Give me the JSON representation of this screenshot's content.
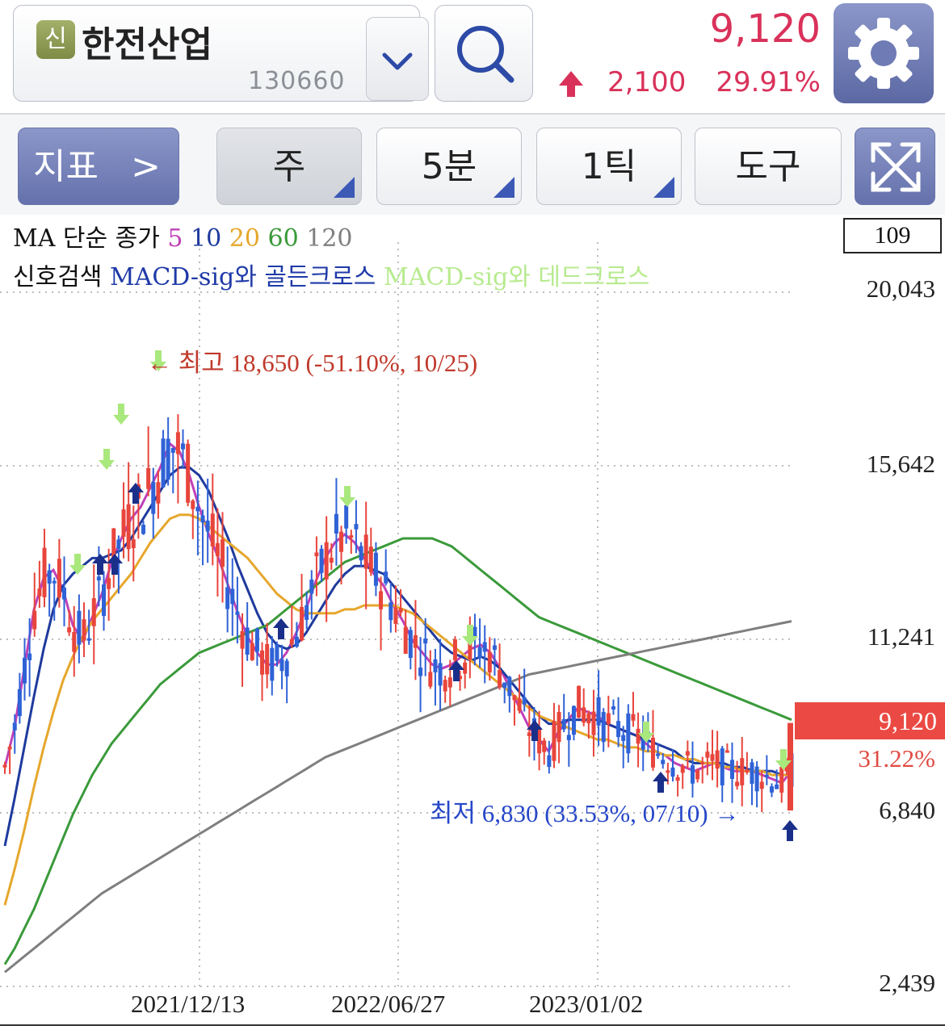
{
  "header": {
    "badge": "신",
    "stock_name": "한전산업",
    "stock_code": "130660",
    "price": "9,120",
    "change": "2,100",
    "change_pct": "29.91%",
    "up_color": "#d9315a"
  },
  "toolbar": {
    "indicator_label": "지표",
    "indicator_chevron": ">",
    "period_label": "주",
    "minute_label": "5분",
    "tick_label": "1틱",
    "tool_label": "도구"
  },
  "legend": {
    "ma_title": "MA 단순 종가",
    "ma_periods": [
      {
        "label": "5",
        "color": "#c040b8"
      },
      {
        "label": "10",
        "color": "#1f3a9e"
      },
      {
        "label": "20",
        "color": "#e6a72c"
      },
      {
        "label": "60",
        "color": "#3a9a3a"
      },
      {
        "label": "120",
        "color": "#7f7f7f"
      }
    ],
    "signal_title": "신호검색",
    "golden_label": "MACD-sig와 골든크로스",
    "golden_color": "#1f3aa8",
    "dead_label": "MACD-sig와 데드크로스",
    "dead_color": "#b7eb8f"
  },
  "volume_box": "109",
  "chart_data": {
    "type": "candlestick",
    "y_axis_labels": [
      "20,043",
      "15,642",
      "11,241",
      "6,840",
      "2,439"
    ],
    "ylim": [
      2439,
      20043
    ],
    "x_axis_labels": [
      "2021/12/13",
      "2022/06/27",
      "2023/01/02"
    ],
    "current_price": "9,120",
    "current_price_pct": "31.22%",
    "high_note": "← 최고 18,650 (-51.10%, 10/25)",
    "low_note": "최저 6,830 (33.53%, 07/10) →",
    "up_color": "#e8453c",
    "down_color": "#2f62d6",
    "ma_series": [
      {
        "name": "5",
        "color": "#c040b8",
        "values": [
          8000,
          9000,
          10500,
          12000,
          12800,
          13000,
          12500,
          11600,
          11200,
          11800,
          12400,
          13200,
          13800,
          14300,
          14600,
          15100,
          15600,
          16200,
          16000,
          15400,
          14600,
          13900,
          13300,
          12600,
          11900,
          11300,
          10900,
          10600,
          10600,
          10900,
          11400,
          12000,
          12700,
          13300,
          13700,
          13900,
          13700,
          13300,
          12900,
          12600,
          12100,
          11700,
          11200,
          10900,
          10600,
          10500,
          10600,
          10800,
          11000,
          11100,
          10900,
          10500,
          10000,
          9500,
          9000,
          8700,
          8400,
          8900,
          9200,
          9500,
          9400,
          9300,
          9100,
          9000,
          8900,
          8800,
          8600,
          8400,
          8300,
          8100,
          8000,
          7900,
          8000,
          8100,
          8000,
          7900,
          7900,
          7900,
          7800,
          7700,
          7600,
          7900
        ]
      },
      {
        "name": "10",
        "color": "#1f3a9e",
        "values": [
          6000,
          7200,
          8500,
          9800,
          11000,
          12000,
          12600,
          12900,
          13100,
          13300,
          13300,
          13400,
          13500,
          13800,
          14200,
          14600,
          15000,
          15400,
          15600,
          15600,
          15400,
          15000,
          14400,
          13800,
          13100,
          12500,
          11900,
          11400,
          11100,
          11000,
          11100,
          11400,
          11800,
          12200,
          12600,
          12900,
          13100,
          13100,
          13000,
          12900,
          12600,
          12300,
          12000,
          11700,
          11400,
          11100,
          10900,
          10800,
          10700,
          10800,
          10700,
          10500,
          10200,
          9900,
          9600,
          9300,
          9100,
          9100,
          9200,
          9200,
          9200,
          9200,
          9100,
          9000,
          8900,
          8800,
          8700,
          8600,
          8500,
          8400,
          8200,
          8100,
          8100,
          8100,
          8100,
          8000,
          8000,
          7900,
          7900,
          7900,
          7800,
          7800
        ]
      },
      {
        "name": "20",
        "color": "#e6a72c",
        "values": [
          4500,
          5400,
          6400,
          7500,
          8500,
          9400,
          10200,
          10800,
          11300,
          11700,
          12000,
          12300,
          12600,
          12900,
          13300,
          13700,
          14000,
          14300,
          14400,
          14400,
          14300,
          14100,
          13900,
          13700,
          13500,
          13300,
          13000,
          12700,
          12400,
          12200,
          12000,
          11900,
          11900,
          11900,
          11900,
          12000,
          12000,
          12100,
          12100,
          12100,
          12100,
          12000,
          11900,
          11700,
          11500,
          11300,
          11100,
          10900,
          10700,
          10500,
          10300,
          10100,
          9900,
          9700,
          9500,
          9300,
          9200,
          9100,
          9000,
          8900,
          8800,
          8700,
          8700,
          8600,
          8500,
          8500,
          8400,
          8400,
          8300,
          8300,
          8200,
          8200,
          8100,
          8100,
          8000,
          8000,
          7900,
          7900,
          7900,
          7800,
          7800,
          7800
        ]
      },
      {
        "name": "60",
        "color": "#3a9a3a",
        "values": [
          3000,
          3400,
          3900,
          4400,
          5000,
          5600,
          6200,
          6800,
          7300,
          7800,
          8200,
          8600,
          8900,
          9200,
          9500,
          9800,
          10100,
          10300,
          10500,
          10700,
          10900,
          11000,
          11100,
          11200,
          11300,
          11400,
          11500,
          11600,
          11800,
          12000,
          12200,
          12400,
          12600,
          12800,
          13000,
          13200,
          13300,
          13400,
          13500,
          13600,
          13700,
          13800,
          13800,
          13800,
          13800,
          13700,
          13600,
          13400,
          13200,
          13000,
          12800,
          12600,
          12400,
          12200,
          12000,
          11800,
          11700,
          11600,
          11500,
          11400,
          11300,
          11200,
          11100,
          11000,
          10900,
          10800,
          10700,
          10600,
          10500,
          10400,
          10300,
          10200,
          10100,
          10000,
          9900,
          9800,
          9700,
          9600,
          9500,
          9400,
          9300,
          9200
        ]
      },
      {
        "name": "120",
        "color": "#7f7f7f",
        "values": [
          2800,
          3000,
          3200,
          3400,
          3600,
          3800,
          4000,
          4200,
          4400,
          4600,
          4800,
          4950,
          5100,
          5250,
          5400,
          5550,
          5700,
          5850,
          6000,
          6150,
          6300,
          6450,
          6600,
          6750,
          6900,
          7050,
          7200,
          7350,
          7500,
          7650,
          7800,
          7950,
          8100,
          8250,
          8350,
          8450,
          8550,
          8650,
          8750,
          8850,
          8950,
          9050,
          9150,
          9250,
          9350,
          9450,
          9550,
          9650,
          9750,
          9850,
          9950,
          10050,
          10150,
          10250,
          10350,
          10400,
          10450,
          10500,
          10550,
          10600,
          10650,
          10700,
          10750,
          10800,
          10850,
          10900,
          10950,
          11000,
          11050,
          11100,
          11150,
          11200,
          11250,
          11300,
          11350,
          11400,
          11450,
          11500,
          11550,
          11600,
          11650,
          11700
        ]
      }
    ]
  }
}
